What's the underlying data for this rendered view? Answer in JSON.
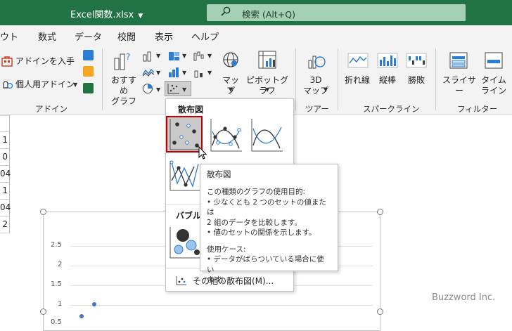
{
  "titlebar": {
    "filename": "Excel関数.xlsx",
    "search_placeholder": "検索 (Alt+Q)",
    "bg": "#217346"
  },
  "menu": {
    "tabs": [
      "ウト",
      "数式",
      "データ",
      "校閲",
      "表示",
      "ヘルプ"
    ]
  },
  "ribbon": {
    "addin": {
      "get_addins": "アドインを入手",
      "my_addins": "個人用アドイン",
      "group": "アドイン"
    },
    "charts": {
      "recommended_line1": "おすすめ",
      "recommended_line2": "グラフ",
      "map": "マップ",
      "pivot": "ピボットグラフ"
    },
    "tour": {
      "map3d_line1": "3D",
      "map3d_line2": "マップ",
      "group": "ツアー"
    },
    "sparkline": {
      "line": "折れ線",
      "column": "縦棒",
      "winloss": "勝敗",
      "group": "スパークライン"
    },
    "filter": {
      "slicer": "スライサー",
      "timeline_line1": "タイム",
      "timeline_line2": "ライン",
      "group": "フィルター"
    }
  },
  "sheet": {
    "row_values": [
      "1",
      "0",
      "04",
      "1",
      "04",
      "2"
    ],
    "chart": {
      "yticks": [
        "2.5",
        "2",
        "1.5",
        "1",
        "0.5"
      ]
    }
  },
  "dropdown": {
    "section_scatter": "散布図",
    "section_bubble": "バブル",
    "more_label": "その他の散布図(M)..."
  },
  "tooltip": {
    "title": "散布図",
    "lines": [
      "この種類のグラフの使用目的:",
      "• 少なくとも 2 つのセットの値または",
      "2 組のデータを比較します。",
      "• 値のセットの関係を示します。"
    ],
    "usecase_title": "使用ケース:",
    "usecase_lines": [
      "• データがばらついている場合に使い",
      "ます。"
    ]
  },
  "watermark": "Buzzword Inc.",
  "colors": {
    "accent": "#217346",
    "selection": "#c00000",
    "series": "#4472c4"
  }
}
